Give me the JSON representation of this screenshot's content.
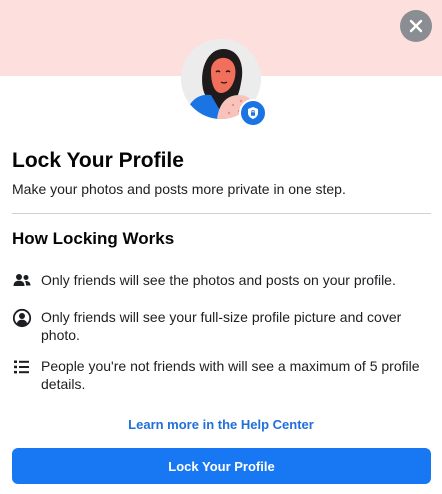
{
  "dialog": {
    "title": "Lock Your Profile",
    "subtitle": "Make your photos and posts more private in one step.",
    "section_title": "How Locking Works",
    "items": [
      {
        "icon": "friends-icon",
        "text": "Only friends will see the photos and posts on your profile."
      },
      {
        "icon": "profile-circle-icon",
        "text": "Only friends will see your full-size profile picture and cover photo."
      },
      {
        "icon": "list-icon",
        "text": "People you're not friends with will see a maximum of 5 profile details."
      }
    ],
    "help_link": "Learn more in the Help Center",
    "primary_button": "Lock Your Profile"
  },
  "colors": {
    "banner": "#fde0dd",
    "accent": "#1877f2",
    "link": "#216fdb",
    "close_button": "#8a8d91"
  },
  "icons": {
    "close": "close-icon",
    "avatar": "avatar-illustration",
    "badge": "shield-lock-icon"
  }
}
